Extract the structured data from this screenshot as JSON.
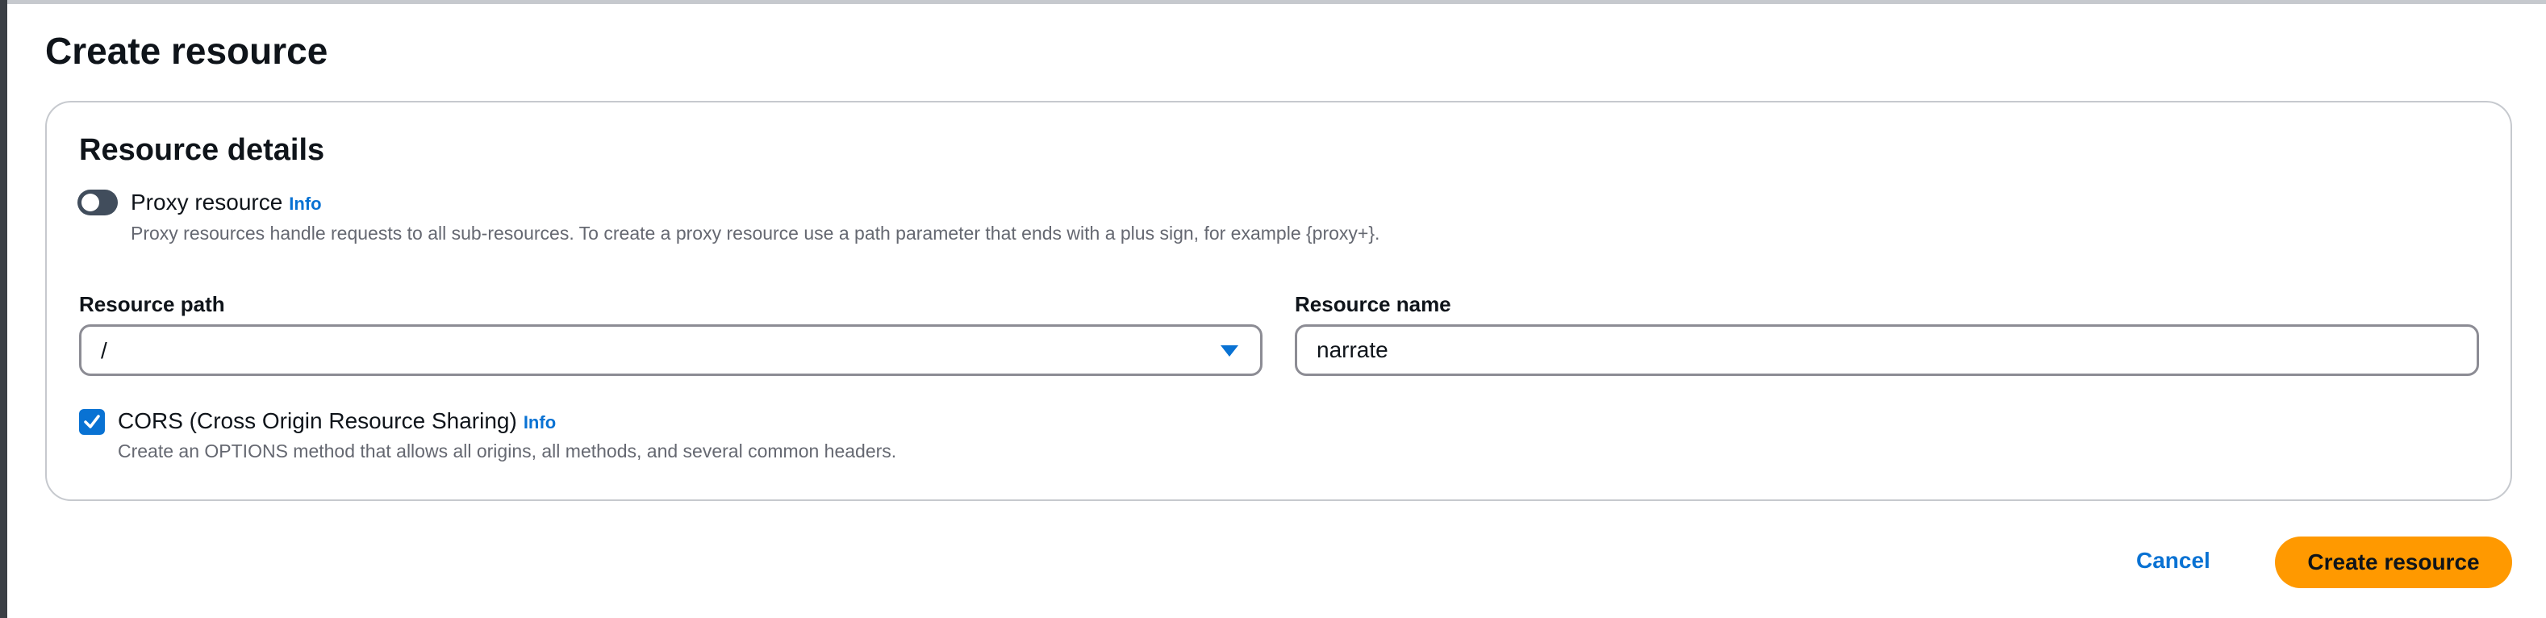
{
  "page": {
    "title": "Create resource"
  },
  "resource_details": {
    "title": "Resource details",
    "proxy_resource": {
      "label": "Proxy resource",
      "info_link": "Info",
      "description": "Proxy resources handle requests to all sub-resources. To create a proxy resource use a path parameter that ends with a plus sign, for example {proxy+}.",
      "enabled": false
    },
    "resource_path": {
      "label": "Resource path",
      "value": "/",
      "icon": "caret-down-icon"
    },
    "resource_name": {
      "label": "Resource name",
      "value": "narrate"
    },
    "cors": {
      "label": "CORS (Cross Origin Resource Sharing)",
      "info_link": "Info",
      "description": "Create an OPTIONS method that allows all origins, all methods, and several common headers.",
      "checked": true
    }
  },
  "actions": {
    "cancel_label": "Cancel",
    "create_label": "Create resource"
  },
  "colors": {
    "link": "#0972d3",
    "primary_button": "#ff9900",
    "checkbox": "#0972d3",
    "toggle_off": "#414d5c",
    "border": "#c6c9ce",
    "input_border": "#8c8c94",
    "secondary_text": "#656871"
  }
}
